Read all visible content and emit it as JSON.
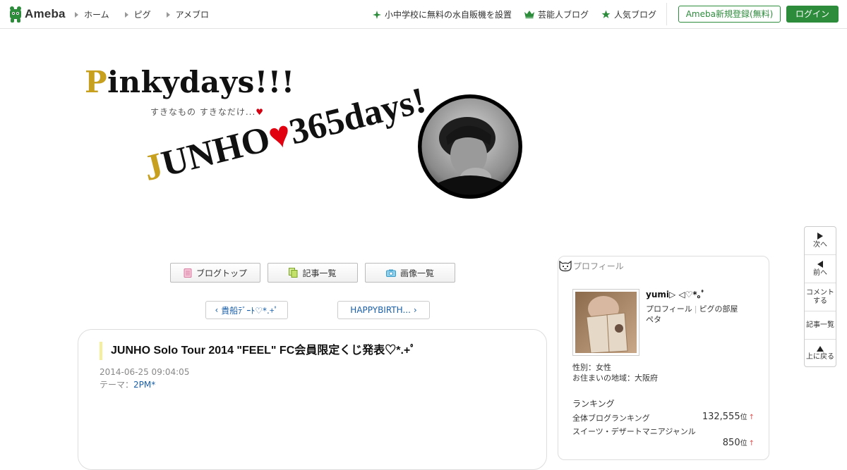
{
  "topbar": {
    "logo_text": "Ameba",
    "nav": [
      {
        "label": "ホーム"
      },
      {
        "label": "ピグ"
      },
      {
        "label": "アメブロ"
      }
    ],
    "links": [
      {
        "label": "小中学校に無料の水自販機を設置",
        "icon": "sparkle-icon"
      },
      {
        "label": "芸能人ブログ",
        "icon": "crown-icon"
      },
      {
        "label": "人気ブログ",
        "icon": "star-icon"
      }
    ],
    "register_label": "Ameba新規登録(無料)",
    "login_label": "ログイン",
    "accent_color": "#2d8c3c"
  },
  "header": {
    "title_cap": "P",
    "title_rest": "inkydays!!!",
    "subtitle": "すきなもの すきなだけ...",
    "subtitle_heart": "♥",
    "banner_cap": "J",
    "banner_mid": "UNHO",
    "banner_heart": "♥",
    "banner_end": "365days!"
  },
  "menu": {
    "blog_top": "ブログトップ",
    "article_list": "記事一覧",
    "image_list": "画像一覧"
  },
  "pager": {
    "prev": "貴船ﾃﾞｰﾄ♡*.+ﾟ",
    "next": "HAPPYBIRTH..."
  },
  "article": {
    "title": "JUNHO Solo Tour 2014 \"FEEL\" FC会員限定くじ発表♡*.+ﾟ",
    "date": "2014-06-25 09:04:05",
    "theme_label": "テーマ：",
    "theme_value": "2PM*"
  },
  "profile": {
    "heading": "プロフィール",
    "name": "yumi▷ ◁♡*｡ﾟ",
    "link_profile": "プロフィール",
    "link_room": "ピグの部屋",
    "pet": "ペタ",
    "gender": "性別：女性",
    "region": "お住まいの地域：大阪府",
    "ranking_heading": "ランキング",
    "rank_all_label": "全体ブログランキング",
    "rank_all_value": "132,555",
    "rank_genre_label": "スイーツ・デザートマニアジャンル",
    "rank_genre_value": "850",
    "rank_unit": "位",
    "rank_arrow": "↑"
  },
  "sidenav": {
    "next": "次へ",
    "prev": "前へ",
    "comment_1": "コメント",
    "comment_2": "する",
    "list": "記事一覧",
    "top": "上に戻る"
  }
}
